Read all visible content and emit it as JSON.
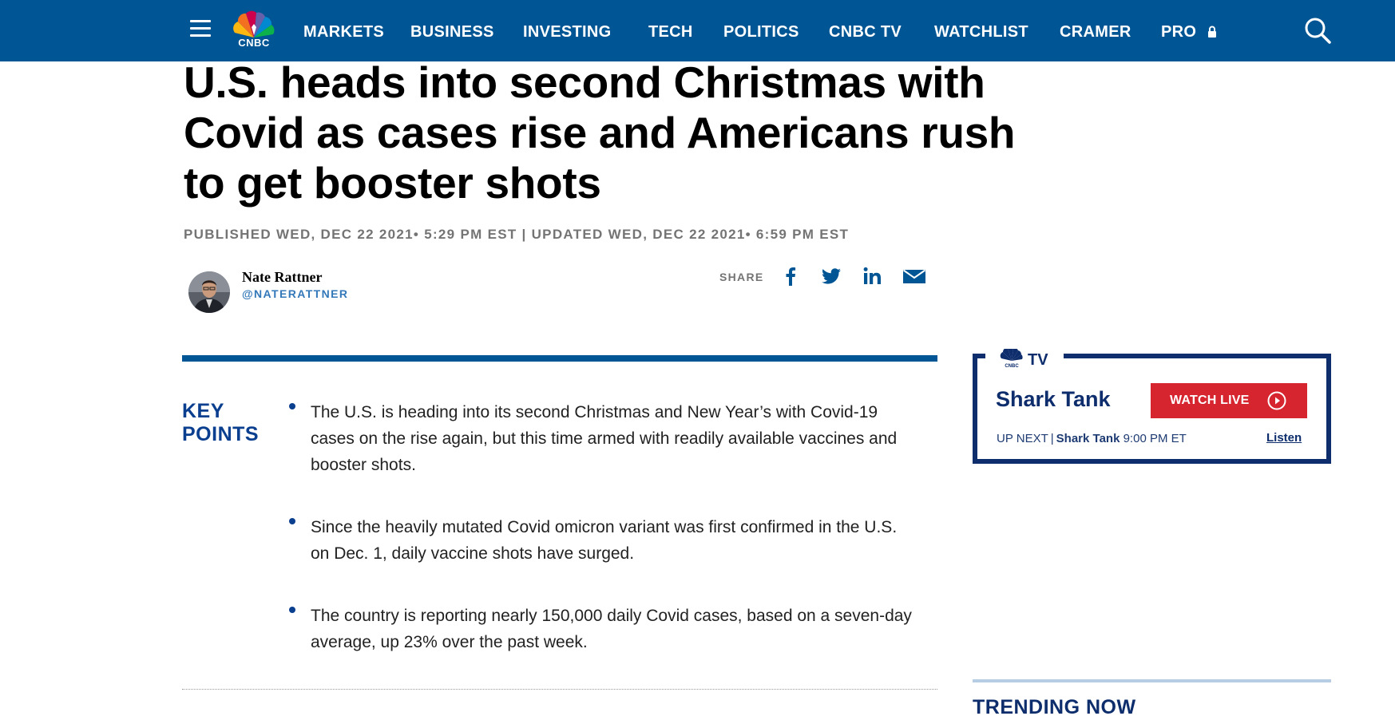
{
  "nav": {
    "logo_text": "CNBC",
    "items": [
      "MARKETS",
      "BUSINESS",
      "INVESTING",
      "TECH",
      "POLITICS",
      "CNBC TV",
      "WATCHLIST",
      "CRAMER",
      "PRO"
    ],
    "icons": {
      "menu": "hamburger-icon",
      "pro": "lock-icon",
      "search": "search-icon"
    },
    "colors": {
      "background": "#005594",
      "text": "#ffffff"
    }
  },
  "article": {
    "headline": "U.S. heads into second Christmas with Covid as cases rise and Americans rush to get booster shots",
    "published": "PUBLISHED WED, DEC 22 2021• 5:29 PM EST",
    "separator": "|",
    "updated": "UPDATED WED, DEC 22 2021• 6:59 PM EST",
    "author": {
      "name": "Nate Rattner",
      "handle": "@NATERATTNER"
    },
    "share": {
      "label": "SHARE",
      "icons": [
        "facebook-icon",
        "twitter-icon",
        "linkedin-icon",
        "email-icon"
      ]
    },
    "key_points": {
      "title_line1": "KEY",
      "title_line2": "POINTS",
      "items": [
        "The U.S. is heading into its second Christmas and New Year’s with Covid-19 cases on the rise again, but this time armed with readily available vaccines and booster shots.",
        "Since the heavily mutated Covid omicron variant was first confirmed in the U.S. on Dec. 1, daily vaccine shots have surged.",
        "The country is reporting nearly 150,000 daily Covid cases, based on a seven-day average, up 23% over the past week."
      ]
    }
  },
  "sidebar": {
    "tv_widget": {
      "logo_text": "TV",
      "show": "Shark Tank",
      "watch_live": "WATCH LIVE",
      "up_next_label": "UP NEXT",
      "up_next_separator": "|",
      "up_next_show": "Shark Tank",
      "up_next_time": "9:00 PM ET",
      "listen": "Listen",
      "colors": {
        "border": "#0d2d6c",
        "button": "#d6252f"
      }
    },
    "trending_title": "TRENDING NOW"
  }
}
